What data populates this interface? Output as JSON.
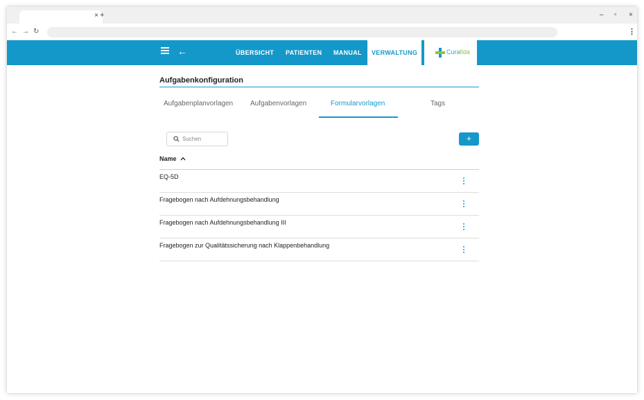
{
  "browser": {
    "tab_close": "×",
    "new_tab": "+",
    "minimize": "–",
    "restore": "▫",
    "close": "×",
    "back": "←",
    "forward": "→",
    "reload": "↻",
    "menu": "⋮"
  },
  "header": {
    "back_glyph": "←",
    "nav": [
      {
        "label": "ÜBERSICHT"
      },
      {
        "label": "PATIENTEN"
      },
      {
        "label": "MANUAL"
      },
      {
        "label": "VERWALTUNG"
      }
    ],
    "logo": {
      "part1": "Cura",
      "part2": "fida"
    },
    "colors": {
      "primary": "#1498c9",
      "logo_green": "#8cc63f"
    }
  },
  "page": {
    "title": "Aufgabenkonfiguration",
    "tabs": [
      {
        "label": "Aufgabenplanvorlagen"
      },
      {
        "label": "Aufgabenvorlagen"
      },
      {
        "label": "Formularvorlagen"
      },
      {
        "label": "Tags"
      }
    ],
    "search_placeholder": "Suchen",
    "add_label": "+",
    "table": {
      "column_name": "Name",
      "rows": [
        {
          "name": "EQ-5D"
        },
        {
          "name": "Fragebogen nach Aufdehnungsbehandlung"
        },
        {
          "name": "Fragebogen nach Aufdehnungsbehandlung III"
        },
        {
          "name": "Fragebogen zur Qualitätssicherung nach Klappenbehandlung"
        }
      ]
    }
  }
}
